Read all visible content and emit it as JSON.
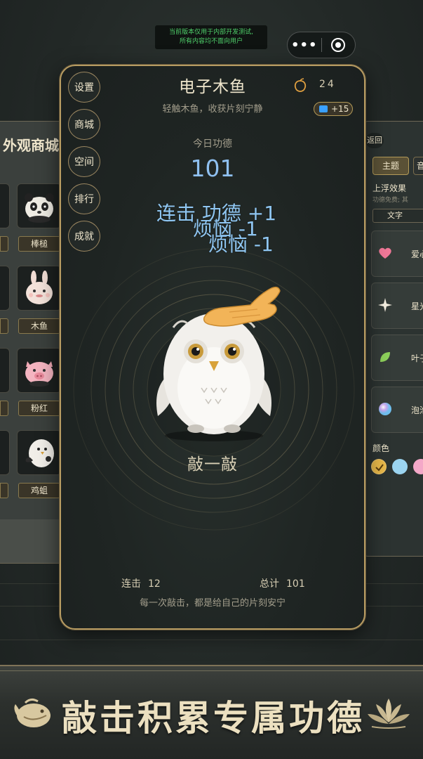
{
  "system": {
    "notice_line1": "当前版本仅用于内部开发测试,",
    "notice_line2": "所有内容均不面向用户",
    "more_glyph": "•••"
  },
  "shop": {
    "title": "外观商城",
    "labels": [
      "棒槌",
      "木鱼",
      "粉红",
      "鸡蛆"
    ]
  },
  "card": {
    "side_buttons": [
      "设置",
      "商城",
      "空间",
      "排行",
      "成就"
    ],
    "title": "电子木鱼",
    "subtitle": "轻触木鱼，收获片刻宁静",
    "coins": "24",
    "bonus": "+15",
    "today_label": "今日功德",
    "today_value": "101",
    "floats": [
      "连击  功德  +1",
      "烦恼 -1",
      "烦恼 -1"
    ],
    "tap_label": "敲一敲",
    "combo_label": "连击",
    "combo_value": "12",
    "total_label": "总计",
    "total_value": "101",
    "footer": "每一次敲击，都是给自己的片刻安宁"
  },
  "settings": {
    "back": "返回",
    "tab_theme": "主题",
    "tab_next": "音",
    "float_title": "上浮效果",
    "float_desc": "功德免费; 其",
    "text_btn": "文字",
    "effects": [
      {
        "icon": "heart-icon",
        "label": "爱心"
      },
      {
        "icon": "sparkle-icon",
        "label": "星光"
      },
      {
        "icon": "leaf-icon",
        "label": "叶子"
      },
      {
        "icon": "bubble-icon",
        "label": "泡泡"
      }
    ],
    "color_title": "颜色",
    "colors": [
      "#e8b84a",
      "#9bd4f0",
      "#f4a8c8"
    ]
  },
  "banner": {
    "slogan": "敲击积累专属功德"
  }
}
